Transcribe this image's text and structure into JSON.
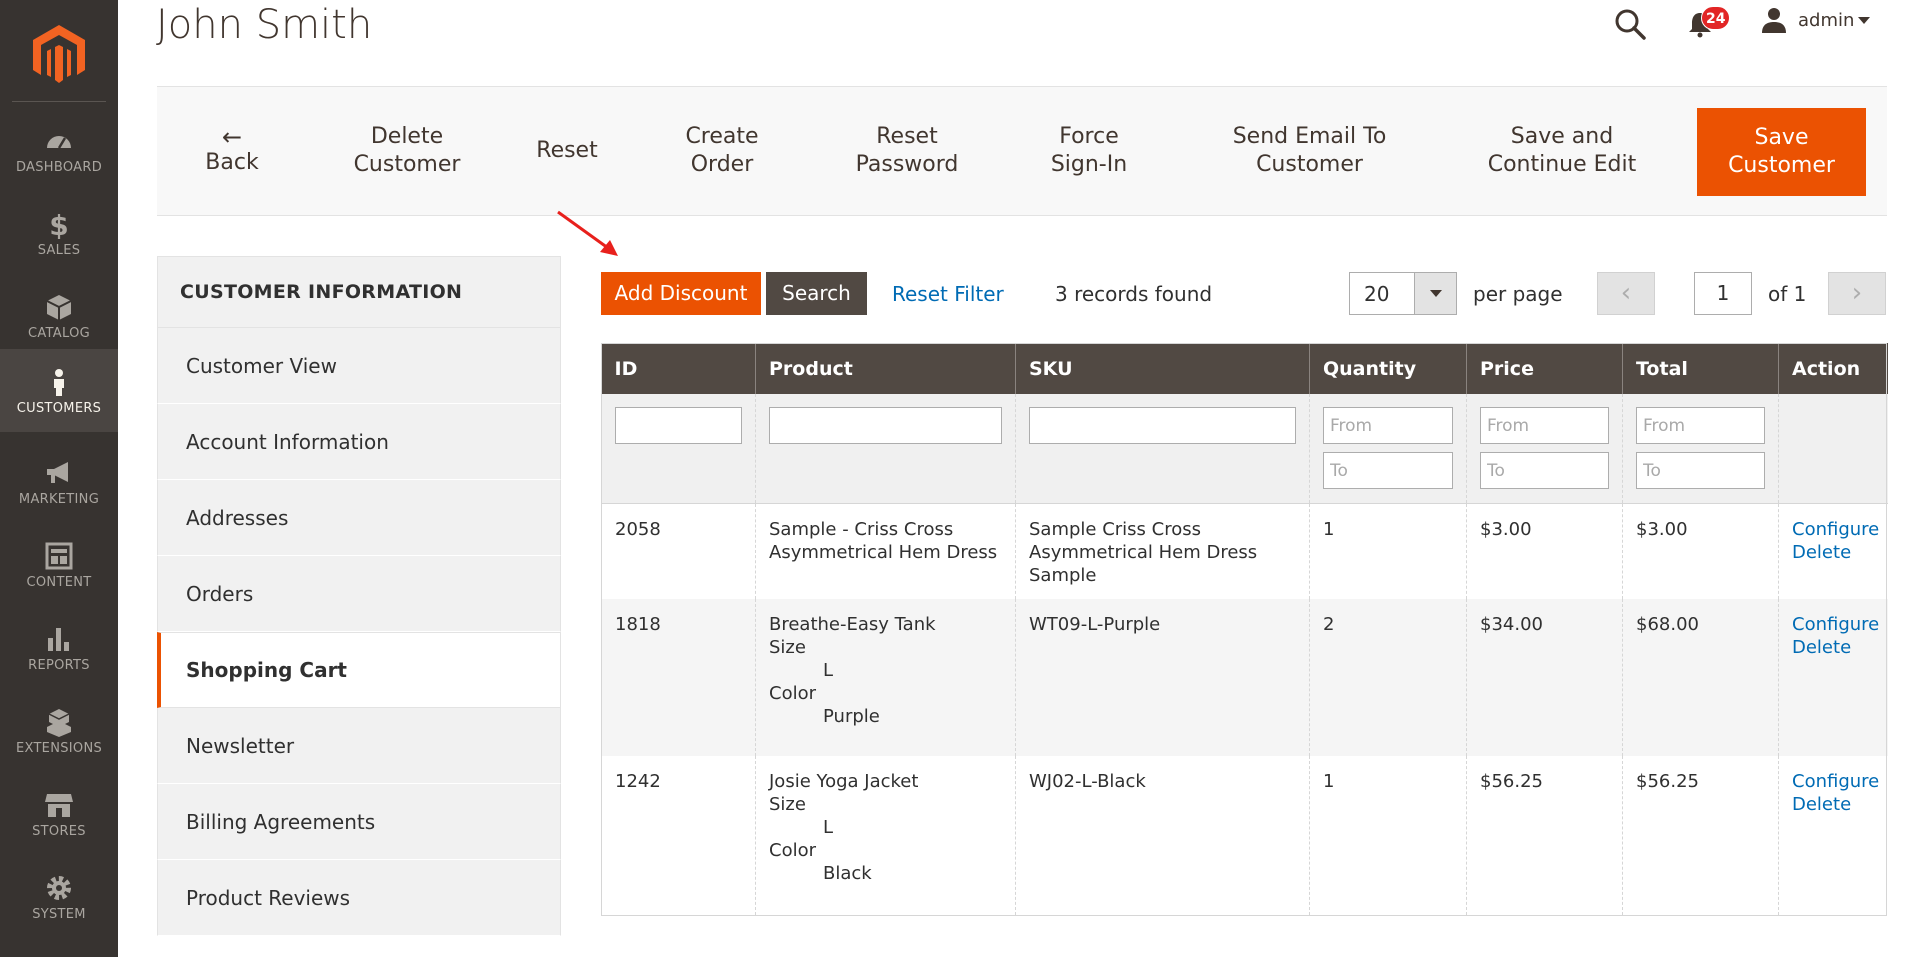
{
  "menu": {
    "items": [
      {
        "label": "DASHBOARD",
        "icon": "dashboard-icon"
      },
      {
        "label": "SALES",
        "icon": "dollar-icon"
      },
      {
        "label": "CATALOG",
        "icon": "cube-icon"
      },
      {
        "label": "CUSTOMERS",
        "icon": "person-icon"
      },
      {
        "label": "MARKETING",
        "icon": "megaphone-icon"
      },
      {
        "label": "CONTENT",
        "icon": "content-layout-icon"
      },
      {
        "label": "REPORTS",
        "icon": "bar-chart-icon"
      },
      {
        "label": "EXTENSIONS",
        "icon": "cubes-icon"
      },
      {
        "label": "STORES",
        "icon": "storefront-icon"
      },
      {
        "label": "SYSTEM",
        "icon": "gear-icon"
      }
    ],
    "active": "CUSTOMERS"
  },
  "header": {
    "title": "John Smith",
    "notifications_count": "24",
    "user_name": "admin"
  },
  "toolbar": {
    "back_arrow": "←",
    "back": "Back",
    "delete_customer": "Delete\nCustomer",
    "reset": "Reset",
    "create_order": "Create\nOrder",
    "reset_password": "Reset\nPassword",
    "force_signin": "Force\nSign-In",
    "send_email": "Send Email To\nCustomer",
    "save_continue": "Save and\nContinue Edit",
    "save_customer": "Save\nCustomer"
  },
  "sidebar": {
    "title": "CUSTOMER INFORMATION",
    "items": [
      "Customer View",
      "Account Information",
      "Addresses",
      "Orders",
      "Shopping Cart",
      "Newsletter",
      "Billing Agreements",
      "Product Reviews"
    ],
    "active": "Shopping Cart"
  },
  "grid_controls": {
    "add_discount": "Add Discount",
    "search": "Search",
    "reset_filter": "Reset Filter",
    "records_found": "3 records found",
    "per_page_value": "20",
    "per_page_label": "per page",
    "prev": "‹",
    "next": "›",
    "page_value": "1",
    "page_of": "of 1"
  },
  "grid": {
    "columns": [
      "ID",
      "Product",
      "SKU",
      "Quantity",
      "Price",
      "Total",
      "Action"
    ],
    "filter_placeholders": {
      "from": "From",
      "to": "To"
    },
    "rows": [
      {
        "id": "2058",
        "product": "Sample - Criss Cross Asymmetrical Hem Dress",
        "options": [],
        "sku": "Sample Criss Cross Asymmetrical Hem Dress Sample",
        "quantity": "1",
        "price": "$3.00",
        "total": "$3.00",
        "actions": [
          "Configure",
          "Delete"
        ]
      },
      {
        "id": "1818",
        "product": "Breathe-Easy Tank",
        "options": [
          {
            "label": "Size",
            "value": "L"
          },
          {
            "label": "Color",
            "value": "Purple"
          }
        ],
        "sku": "WT09-L-Purple",
        "quantity": "2",
        "price": "$34.00",
        "total": "$68.00",
        "actions": [
          "Configure",
          "Delete"
        ]
      },
      {
        "id": "1242",
        "product": "Josie Yoga Jacket",
        "options": [
          {
            "label": "Size",
            "value": "L"
          },
          {
            "label": "Color",
            "value": "Black"
          }
        ],
        "sku": "WJ02-L-Black",
        "quantity": "1",
        "price": "$56.25",
        "total": "$56.25",
        "actions": [
          "Configure",
          "Delete"
        ]
      }
    ]
  },
  "colors": {
    "accent": "#eb5202",
    "menu_bg": "#373330",
    "header_dark": "#514943",
    "link": "#006bb4",
    "annotation": "#e8201c"
  }
}
